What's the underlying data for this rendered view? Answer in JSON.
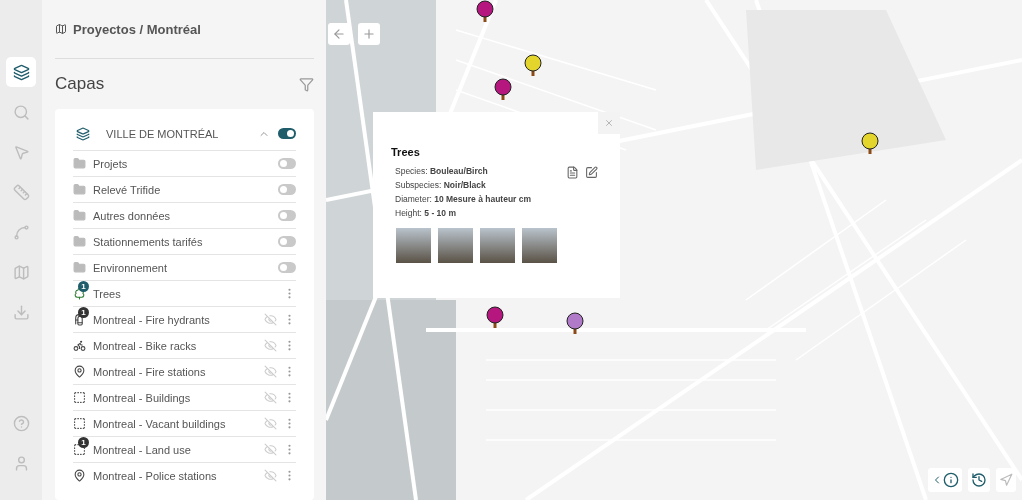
{
  "rail": {
    "items": [
      {
        "kind": "layers",
        "selected": true
      },
      {
        "kind": "search",
        "selected": false
      },
      {
        "kind": "pointer",
        "selected": false
      },
      {
        "kind": "ruler",
        "selected": false
      },
      {
        "kind": "shape",
        "selected": false
      },
      {
        "kind": "map",
        "selected": false
      },
      {
        "kind": "download",
        "selected": false
      }
    ],
    "bottom": [
      {
        "kind": "help",
        "selected": false
      },
      {
        "kind": "user",
        "selected": false
      }
    ]
  },
  "breadcrumb": "Proyectos / Montréal",
  "panel_title": "Capas",
  "group": {
    "title": "VILLE DE MONTRÉAL",
    "expanded": true,
    "on": true,
    "items": [
      {
        "kind": "folder",
        "label": "Projets",
        "on": false
      },
      {
        "kind": "folder",
        "label": "Relevé Trifide",
        "on": false
      },
      {
        "kind": "folder",
        "label": "Autres données",
        "on": false
      },
      {
        "kind": "folder",
        "label": "Stationnements tarifés",
        "on": false
      },
      {
        "kind": "folder",
        "label": "Environnement",
        "on": false
      },
      {
        "kind": "tree",
        "label": "Trees",
        "badge": "1",
        "hidden": false
      },
      {
        "kind": "hydrant",
        "label": "Montreal - Fire hydrants",
        "badge": "1",
        "hidden": true
      },
      {
        "kind": "bike",
        "label": "Montreal - Bike racks",
        "hidden": true
      },
      {
        "kind": "pin",
        "label": "Montreal - Fire stations",
        "hidden": true
      },
      {
        "kind": "hatch",
        "label": "Montreal - Buildings",
        "hidden": true
      },
      {
        "kind": "hatch",
        "label": "Montreal - Vacant buildings",
        "hidden": true
      },
      {
        "kind": "area",
        "label": "Montreal - Land use",
        "badge": "1",
        "hidden": true
      },
      {
        "kind": "pin",
        "label": "Montreal - Police stations",
        "hidden": true
      }
    ]
  },
  "popup": {
    "title": "Trees",
    "fields": [
      {
        "label": "Species:",
        "value": "Bouleau/Birch"
      },
      {
        "label": "Subspecies:",
        "value": "Noir/Black"
      },
      {
        "label": "Diameter:",
        "value": "10 Mesure à hauteur cm"
      },
      {
        "label": "Height:",
        "value": "5 - 10 m"
      }
    ],
    "photos": [
      {
        "kind": "photo"
      },
      {
        "kind": "photo"
      },
      {
        "kind": "photo"
      },
      {
        "kind": "photo"
      }
    ]
  },
  "markers": [
    {
      "color": "#b5177f"
    },
    {
      "color": "#e3d52c"
    },
    {
      "color": "#b5177f"
    },
    {
      "color": "#e3d52c"
    },
    {
      "color": "#b5177f"
    },
    {
      "color": "#b07ac8"
    }
  ]
}
